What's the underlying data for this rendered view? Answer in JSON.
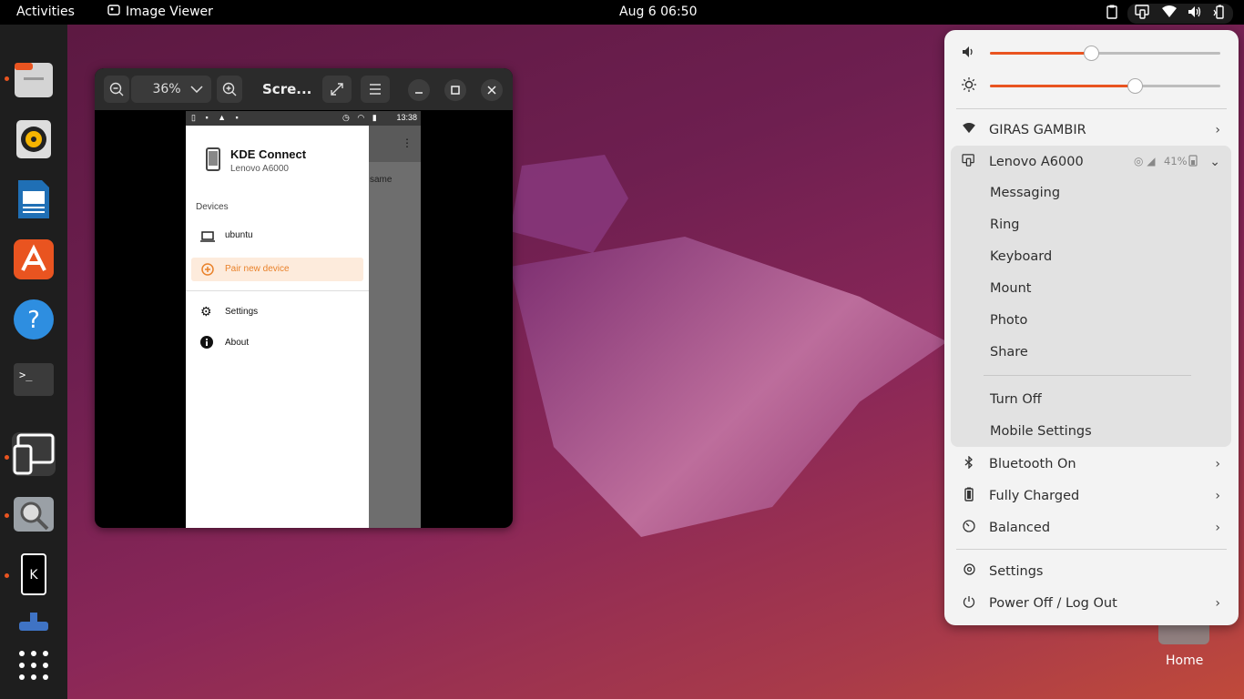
{
  "topbar": {
    "activities": "Activities",
    "app_name": "Image Viewer",
    "clock": "Aug 6  06:50"
  },
  "viewer": {
    "zoom": "36%",
    "title": "Scre..."
  },
  "phone": {
    "time": "13:38",
    "app_title": "KDE Connect",
    "device_model": "Lenovo A6000",
    "devices_header": "Devices",
    "device_ubuntu": "ubuntu",
    "pair_new": "Pair new device",
    "settings": "Settings",
    "about": "About",
    "behind_text": "same"
  },
  "panel": {
    "volume_level": 0.44,
    "brightness_level": 0.63,
    "wifi": "GIRAS GAMBIR",
    "device": {
      "name": "Lenovo A6000",
      "battery": "41%",
      "actions": [
        "Messaging",
        "Ring",
        "Keyboard",
        "Mount",
        "Photo",
        "Share"
      ],
      "turn_off": "Turn Off",
      "mobile_settings": "Mobile Settings"
    },
    "bluetooth": "Bluetooth On",
    "power": "Fully Charged",
    "profile": "Balanced",
    "settings": "Settings",
    "power_off": "Power Off / Log Out"
  },
  "desktop": {
    "home_label": "Home"
  },
  "colors": {
    "accent": "#e95420",
    "panel_bg": "#f3f3f3"
  }
}
